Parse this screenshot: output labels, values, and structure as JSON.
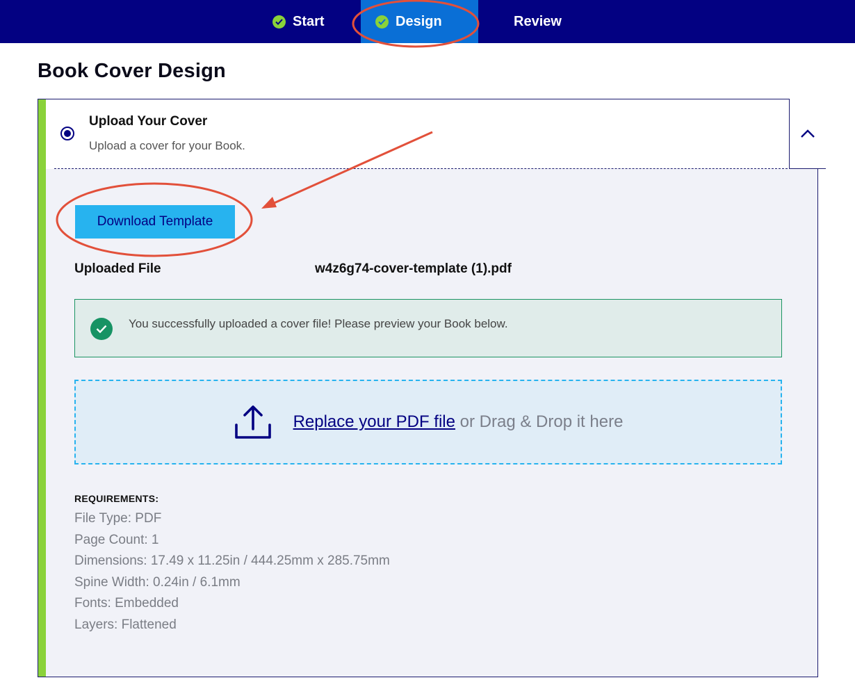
{
  "nav": {
    "steps": [
      {
        "label": "Start",
        "status": "complete"
      },
      {
        "label": "Design",
        "status": "active"
      },
      {
        "label": "Review",
        "status": "pending"
      }
    ],
    "background": "#030182",
    "active_background": "#0a6fd6",
    "check_color": "#8ad23a"
  },
  "page": {
    "title": "Book Cover Design"
  },
  "section": {
    "title": "Upload Your Cover",
    "subtitle": "Upload a cover for your Book.",
    "collapse_icon": "chevron-up-icon"
  },
  "download_button": {
    "label": "Download Template"
  },
  "uploaded": {
    "label": "Uploaded File",
    "filename": "w4z6g74-cover-template (1).pdf"
  },
  "success": {
    "message": "You successfully uploaded a cover file! Please preview your Book below.",
    "color": "#179364"
  },
  "dropzone": {
    "link_text": "Replace your PDF file",
    "rest_text": " or Drag & Drop it here",
    "icon": "upload-icon"
  },
  "requirements": {
    "title": "REQUIREMENTS:",
    "items": [
      "File Type: PDF",
      "Page Count: 1",
      "Dimensions: 17.49 x 11.25in / 444.25mm x 285.75mm",
      "Spine Width: 0.24in / 6.1mm",
      "Fonts: Embedded",
      "Layers: Flattened"
    ]
  },
  "annotation_color": "#e2503a"
}
